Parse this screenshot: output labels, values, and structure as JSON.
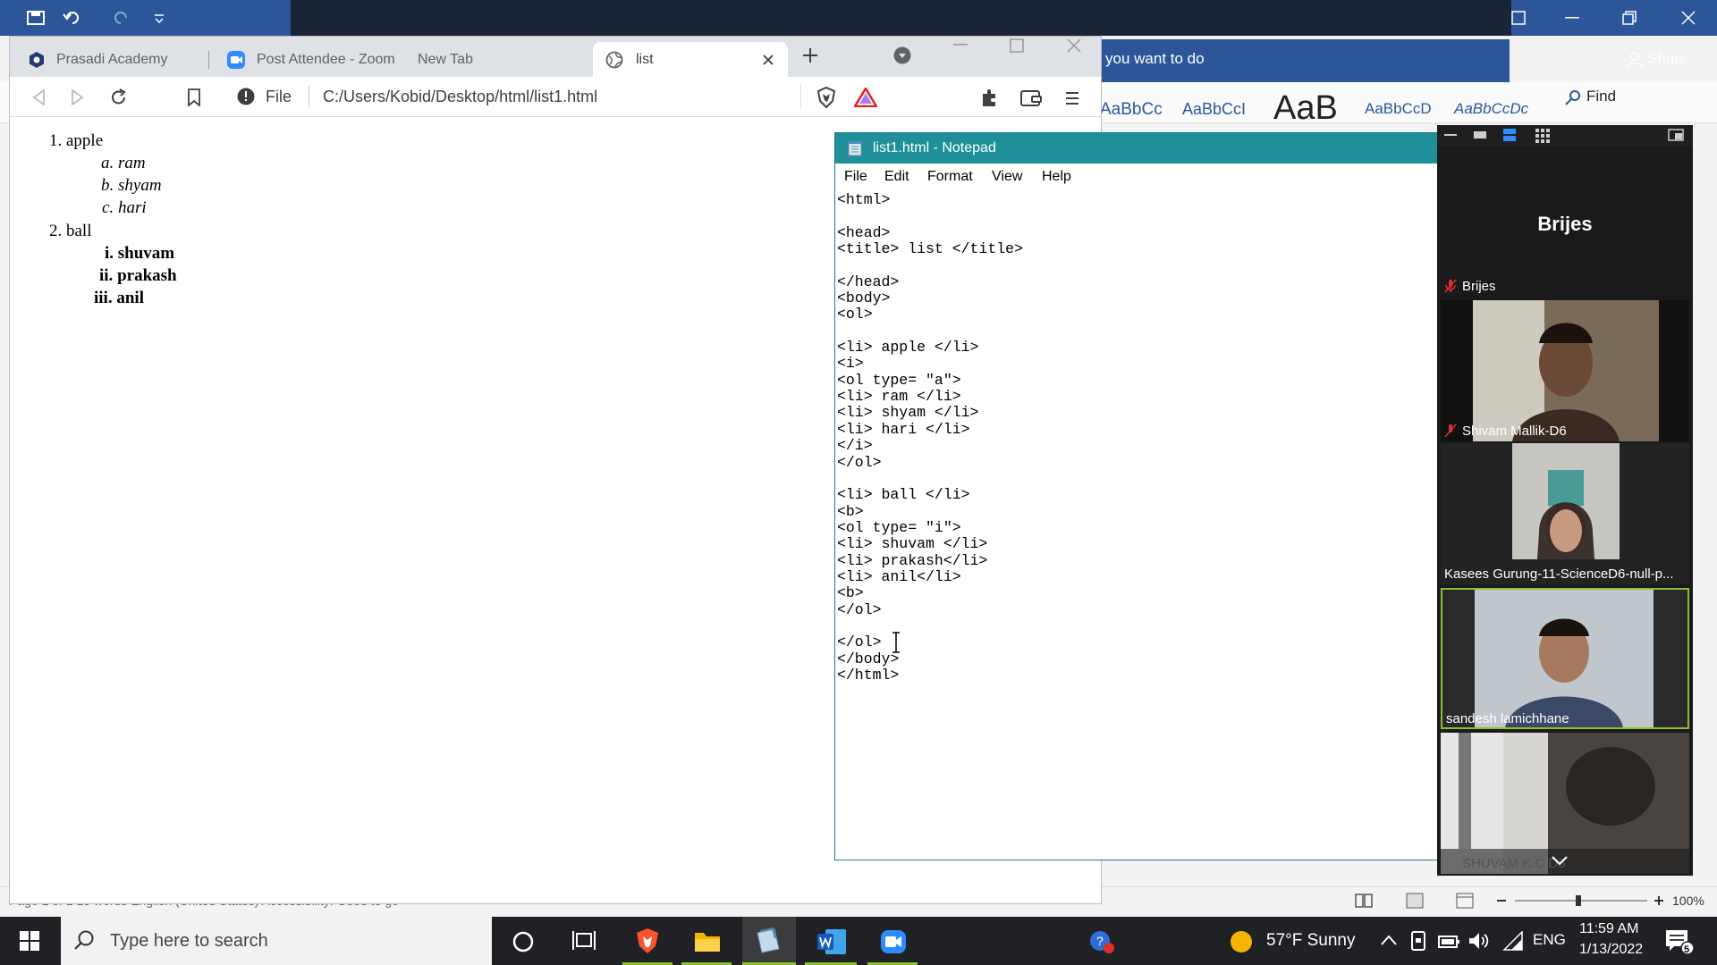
{
  "word": {
    "tell_me": "you want to do",
    "share": "Share",
    "styles": [
      "AaBbCc",
      "AaBbCcI",
      "AaB",
      "AaBbCcD",
      "AaBbCcDc"
    ],
    "find": "Find",
    "status_left": "Page 1 of 1     15 words     English (United States)     Accessibility: Good to go",
    "zoom": "100%"
  },
  "browser": {
    "tabs": [
      {
        "label": "Prasadi Academy",
        "icon": "prasadi-icon"
      },
      {
        "label": "Post Attendee - Zoom",
        "icon": "zoom-icon"
      },
      {
        "label": "New Tab",
        "icon": ""
      },
      {
        "label": "list",
        "icon": "globe-icon"
      }
    ],
    "url_scheme": "File",
    "url": "C:/Users/Kobid/Desktop/html/list1.html",
    "page": {
      "items": [
        {
          "marker": "1.",
          "label": "apple",
          "sub": [
            {
              "marker": "a.",
              "label": "ram"
            },
            {
              "marker": "b.",
              "label": "shyam"
            },
            {
              "marker": "c.",
              "label": "hari"
            }
          ]
        },
        {
          "marker": "2.",
          "label": "ball",
          "sub": [
            {
              "marker": "i.",
              "label": "shuvam"
            },
            {
              "marker": "ii.",
              "label": "prakash"
            },
            {
              "marker": "iii.",
              "label": "anil"
            }
          ]
        }
      ]
    }
  },
  "notepad": {
    "title": "list1.html - Notepad",
    "menu": [
      "File",
      "Edit",
      "Format",
      "View",
      "Help"
    ],
    "lines": [
      "<html>",
      "",
      "<head>",
      "<title> list </title>",
      "",
      "</head>",
      "<body>",
      "<ol>",
      "",
      "<li> apple </li>",
      "<i>",
      "<ol type= \"a\">",
      "<li> ram </li>",
      "<li> shyam </li>",
      "<li> hari </li>",
      "</i>",
      "</ol>",
      "",
      "<li> ball </li>",
      "<b>",
      "<ol type= \"i\">",
      "<li> shuvam </li>",
      "<li> prakash</li>",
      "<li> anil</li>",
      "<b>",
      "</ol>",
      "",
      "</ol>",
      "</body>",
      "</html>"
    ]
  },
  "zoom": {
    "host_name": "Brijes",
    "host_label": "Brijes",
    "participants": [
      "Shivam Mallik-D6",
      "Kasees   Gurung-11-ScienceD6-null-p...",
      "sandesh lamichhane",
      "SHUVAM K.C D6"
    ]
  },
  "taskbar": {
    "search_placeholder": "Type here to search",
    "weather": "57°F  Sunny",
    "lang": "ENG",
    "time": "11:59 AM",
    "date": "1/13/2022",
    "notif_count": "5"
  },
  "colors": {
    "word_blue": "#2b579a",
    "notepad_title": "#1f8f99",
    "zoom_bg": "#1a1a1a",
    "taskbar": "#202124",
    "brave_orange": "#fb542b",
    "speaker_green": "#8dbf2e"
  }
}
